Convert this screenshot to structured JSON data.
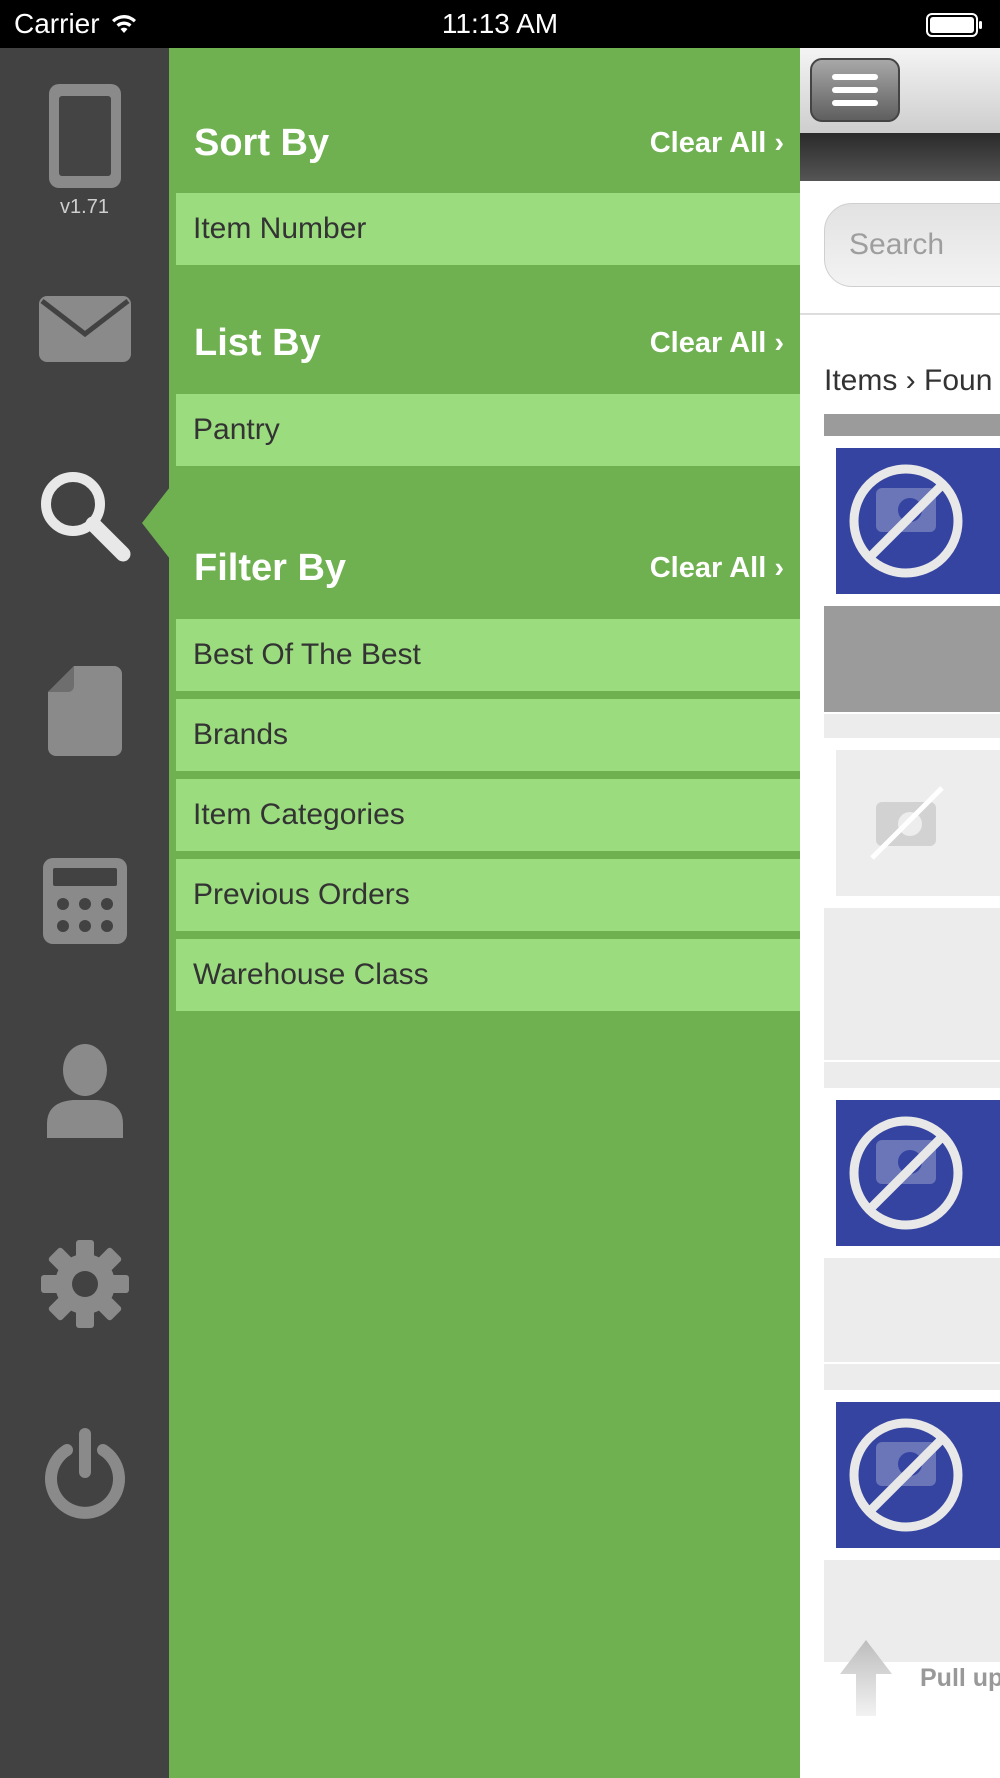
{
  "status_bar": {
    "carrier": "Carrier",
    "time": "11:13 AM"
  },
  "rail": {
    "version": "v1.71",
    "items": [
      {
        "icon": "tablet-icon"
      },
      {
        "icon": "envelope-icon"
      },
      {
        "icon": "search-icon",
        "selected": true
      },
      {
        "icon": "document-icon"
      },
      {
        "icon": "calculator-icon"
      },
      {
        "icon": "user-icon"
      },
      {
        "icon": "gear-icon"
      },
      {
        "icon": "power-icon"
      }
    ]
  },
  "filter_panel": {
    "sort": {
      "title": "Sort By",
      "clear": "Clear All ›",
      "options": [
        "Item Number"
      ]
    },
    "list": {
      "title": "List By",
      "clear": "Clear All ›",
      "options": [
        "Pantry"
      ]
    },
    "filter": {
      "title": "Filter By",
      "clear": "Clear All ›",
      "options": [
        "Best Of The Best",
        "Brands",
        "Item Categories",
        "Previous Orders",
        "Warehouse Class"
      ]
    }
  },
  "main": {
    "search_placeholder": "Search",
    "breadcrumb": "Items › Foun",
    "pull_hint": "Pull up"
  },
  "colors": {
    "panel": "#6fb050",
    "row": "#9bdc7e",
    "rail": "#424242",
    "thumb_blue": "#3544a0"
  }
}
